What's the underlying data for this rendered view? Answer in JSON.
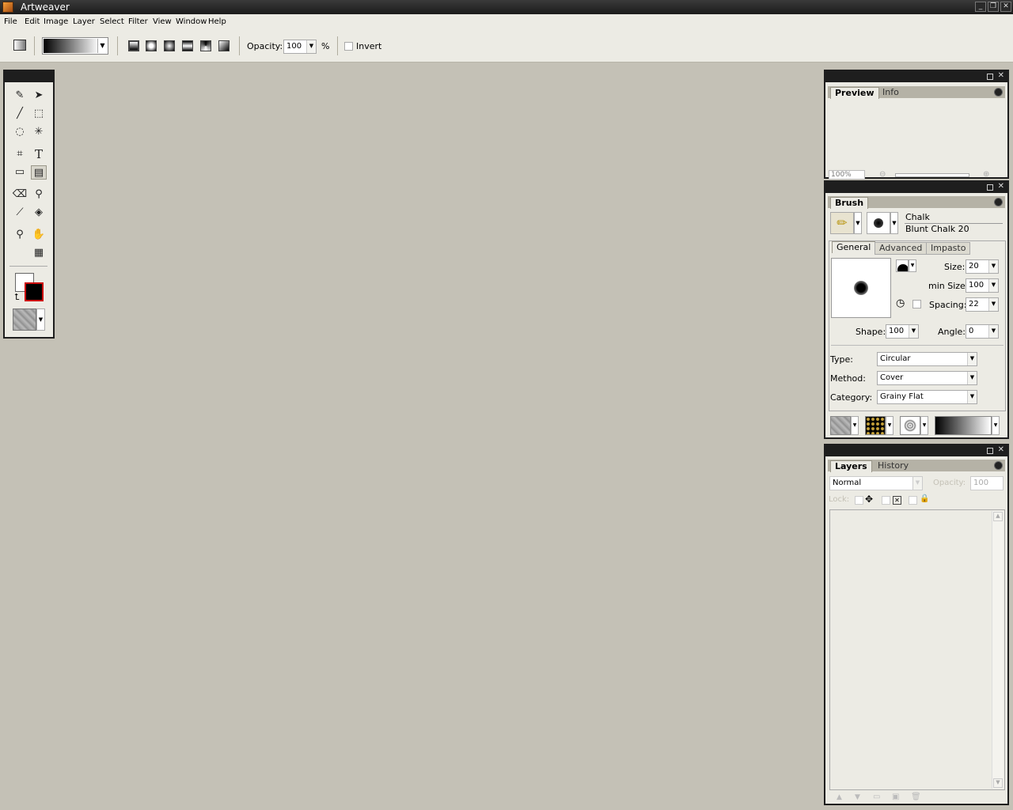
{
  "app": {
    "title": "Artweaver"
  },
  "window_controls": {
    "minimize": "_",
    "restore": "❐",
    "close": "✕"
  },
  "menu": [
    "File",
    "Edit",
    "Image",
    "Layer",
    "Select",
    "Filter",
    "View",
    "Window",
    "Help"
  ],
  "options": {
    "opacity_label": "Opacity:",
    "opacity_value": "100",
    "percent": "%",
    "invert_label": "Invert",
    "gradient_types": [
      "linear-gradient-icon",
      "radial-gradient-icon",
      "square-gradient-icon",
      "reflected-gradient-icon",
      "spiral-gradient-icon",
      "diagonal-gradient-icon"
    ]
  },
  "toolbox": {
    "tools": [
      {
        "name": "brush-tool",
        "glyph": "✎"
      },
      {
        "name": "move-tool",
        "glyph": "➤"
      },
      {
        "name": "line-tool",
        "glyph": "╱"
      },
      {
        "name": "rect-select-tool",
        "glyph": "⬚"
      },
      {
        "name": "lasso-tool",
        "glyph": "◌"
      },
      {
        "name": "magic-wand-tool",
        "glyph": "✳"
      },
      {
        "name": "crop-tool",
        "glyph": "⌗"
      },
      {
        "name": "text-tool",
        "glyph": "T"
      },
      {
        "name": "rectangle-tool",
        "glyph": "▭"
      },
      {
        "name": "gradient-tool",
        "glyph": "▤"
      },
      {
        "name": "eraser-tool",
        "glyph": "⌫"
      },
      {
        "name": "clone-stamp-tool",
        "glyph": "⚲"
      },
      {
        "name": "eyedropper-tool",
        "glyph": "⟋"
      },
      {
        "name": "paint-bucket-tool",
        "glyph": "◈"
      },
      {
        "name": "zoom-tool",
        "glyph": "⚲"
      },
      {
        "name": "hand-tool",
        "glyph": "✋"
      },
      {
        "name": "grid-tool",
        "glyph": "▦"
      }
    ],
    "fg_color": "#ffffff",
    "bg_color": "#000000"
  },
  "preview_panel": {
    "tabs": [
      "Preview",
      "Info"
    ],
    "zoom_value": "100%"
  },
  "brush_panel": {
    "tab": "Brush",
    "brush_category": "Chalk",
    "brush_variant": "Blunt Chalk 20",
    "subtabs": [
      "General",
      "Advanced",
      "Impasto"
    ],
    "size_label": "Size:",
    "size_value": "20",
    "min_size_label": "min Size:",
    "min_size_value": "100",
    "spacing_label": "Spacing:",
    "spacing_value": "22",
    "shape_label": "Shape:",
    "shape_value": "100",
    "angle_label": "Angle:",
    "angle_value": "0",
    "type_label": "Type:",
    "type_value": "Circular",
    "method_label": "Method:",
    "method_value": "Cover",
    "category_label": "Category:",
    "category_value": "Grainy Flat"
  },
  "layers_panel": {
    "tabs": [
      "Layers",
      "History"
    ],
    "blend_mode": "Normal",
    "opacity_label": "Opacity:",
    "opacity_value": "100",
    "lock_label": "Lock:"
  },
  "colors": {
    "titlebar": "#1b1b1b",
    "workspace": "#c4c1b6",
    "panel": "#ecebe4"
  }
}
